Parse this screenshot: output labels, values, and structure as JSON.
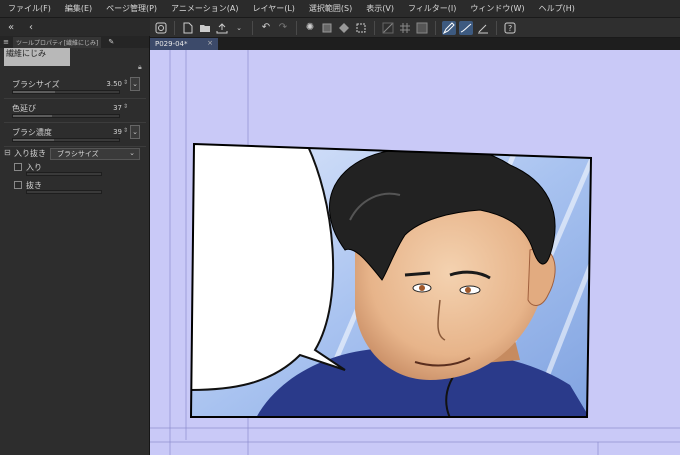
{
  "menu": [
    "ファイル(F)",
    "編集(E)",
    "ページ管理(P)",
    "アニメーション(A)",
    "レイヤー(L)",
    "選択範囲(S)",
    "表示(V)",
    "フィルター(I)",
    "ウィンドウ(W)",
    "ヘルプ(H)"
  ],
  "left_toolbar": {
    "collapse_icon": "«",
    "back_icon": "‹"
  },
  "panel": {
    "tab_label": "ツールプロパティ[繊維にじみ]",
    "sub_tool_name": "繊維にじみ",
    "brush_size": {
      "label": "ブラシサイズ",
      "value": "3.50",
      "fill": 0.4
    },
    "color_stretch": {
      "label": "色延び",
      "value": "37",
      "fill": 0.37
    },
    "brush_density": {
      "label": "ブラシ濃度",
      "value": "39",
      "fill": 0.39
    },
    "taper": {
      "label": "入り抜き",
      "select_value": "ブラシサイズ"
    },
    "entry": {
      "label": "入り"
    },
    "exit": {
      "label": "抜き"
    }
  },
  "document": {
    "tab_name": "P029-04*",
    "close_glyph": "×"
  },
  "colors": {
    "canvas_bg": "#c9c9f7",
    "toolbar_active": "#3d5a80",
    "panel_bg": "#2d2d2d"
  }
}
